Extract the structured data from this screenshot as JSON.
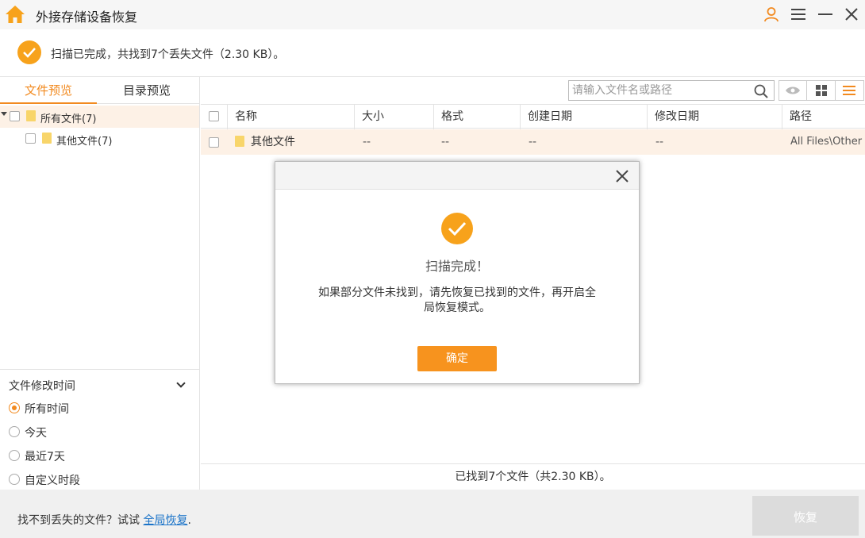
{
  "app": {
    "title": "外接存储设备恢复",
    "icons": {
      "home": "home-icon",
      "user": "user-icon",
      "menu": "menu-icon",
      "minimize": "minimize-icon",
      "close": "close-icon"
    },
    "accent": "#f28a1f"
  },
  "banner": {
    "text": "扫描已完成，共找到7个丢失文件（2.30 KB）。"
  },
  "left": {
    "tabs": [
      "文件预览",
      "目录预览"
    ],
    "active_tab": 0,
    "tree": [
      {
        "label": "所有文件(7)",
        "level": 0
      },
      {
        "label": "其他文件(7)",
        "level": 1
      }
    ],
    "filter": {
      "title": "文件修改时间",
      "options": [
        "所有时间",
        "今天",
        "最近7天",
        "自定义时段"
      ],
      "selected": 0
    }
  },
  "right": {
    "search": {
      "placeholder": "请输入文件名或路径"
    },
    "view_buttons": [
      "preview-eye-icon",
      "grid-view-icon",
      "list-view-icon"
    ],
    "columns": [
      "名称",
      "大小",
      "格式",
      "创建日期",
      "修改日期",
      "路径"
    ],
    "rows": [
      {
        "name": "其他文件",
        "size": "--",
        "format": "--",
        "created": "--",
        "modified": "--",
        "path": "All Files\\Other"
      }
    ],
    "status": "已找到7个文件（共2.30 KB）。"
  },
  "footer": {
    "prompt": "找不到丢失的文件？试试 ",
    "link": "全局恢复",
    "suffix": ".",
    "recover_button": "恢复"
  },
  "dialog": {
    "title": "扫描完成！",
    "message": "如果部分文件未找到，请先恢复已找到的文件，再开启全局恢复模式。",
    "ok": "确定"
  }
}
